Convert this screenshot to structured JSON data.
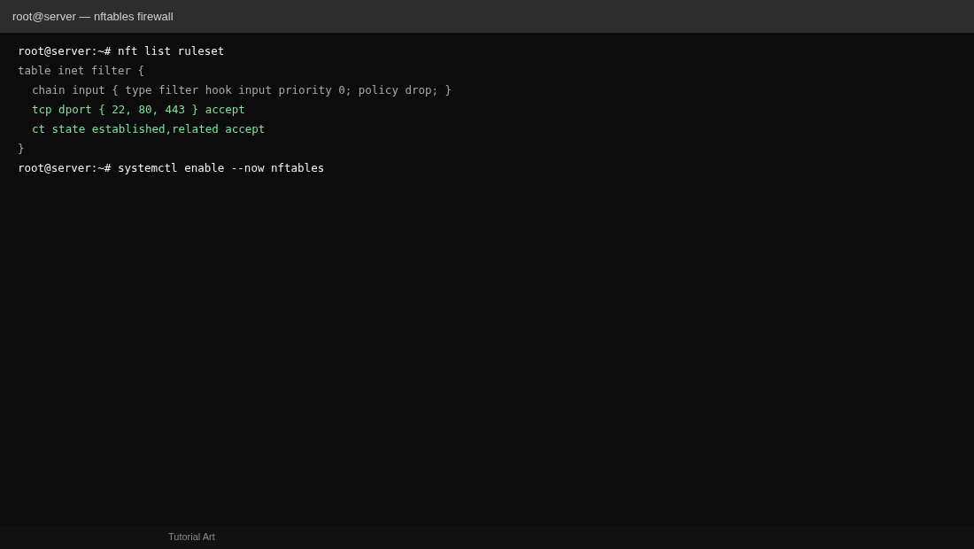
{
  "window": {
    "title": "root@server — nftables firewall"
  },
  "terminal": {
    "lines": [
      {
        "kind": "command",
        "text": "root@server:~# nft list ruleset"
      },
      {
        "kind": "output",
        "text": "table inet filter {",
        "children": [
          {
            "kind": "output",
            "text": "chain input { type filter hook input priority 0; policy drop; }"
          },
          {
            "kind": "rule",
            "text": "tcp dport { 22, 80, 443 } accept"
          },
          {
            "kind": "rule",
            "text": "ct state established,related accept"
          }
        ]
      },
      {
        "kind": "output",
        "text": "}"
      },
      {
        "kind": "command",
        "text": "root@server:~# systemctl enable --now nftables"
      }
    ]
  },
  "status_bar": {
    "text": "Tutorial Art"
  }
}
